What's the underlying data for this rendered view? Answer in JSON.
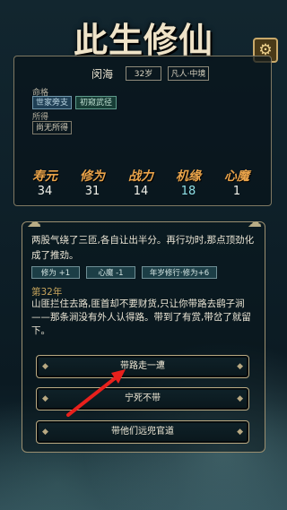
{
  "game": {
    "title": "此生修仙"
  },
  "settings": {
    "icon": "gear-icon",
    "glyph": "⚙"
  },
  "character": {
    "name": "闵海",
    "age": "32岁",
    "realm": "凡人·中境",
    "fate_label": "命格",
    "fates": [
      "世家旁支",
      "初窥武径"
    ],
    "owned_label": "所得",
    "owned": [
      "尚无所得"
    ]
  },
  "stats": [
    {
      "label": "寿元",
      "value": "34",
      "highlight": false
    },
    {
      "label": "修为",
      "value": "31",
      "highlight": false
    },
    {
      "label": "战力",
      "value": "14",
      "highlight": false
    },
    {
      "label": "机缘",
      "value": "18",
      "highlight": true
    },
    {
      "label": "心魔",
      "value": "1",
      "highlight": false
    }
  ],
  "story": {
    "previous_text": "两股气绕了三匝,各自让出半分。再行功时,那点顶劲化成了推劲。",
    "effects": [
      "修为 +1",
      "心魔 -1",
      "年岁修行·修为+6"
    ],
    "year_label": "第32年",
    "event_text": "山匪拦住去路,匪首却不要财货,只让你带路去鹞子涧——那条涧没有外人认得路。带到了有赏,带岔了就留下。"
  },
  "choices": [
    {
      "label": "带路走一遭"
    },
    {
      "label": "宁死不带"
    },
    {
      "label": "带他们远兜官道"
    }
  ],
  "colors": {
    "accent_gold": "#e9a34a",
    "luck_cyan": "#8fe0e6",
    "arrow_red": "#e8201c"
  }
}
